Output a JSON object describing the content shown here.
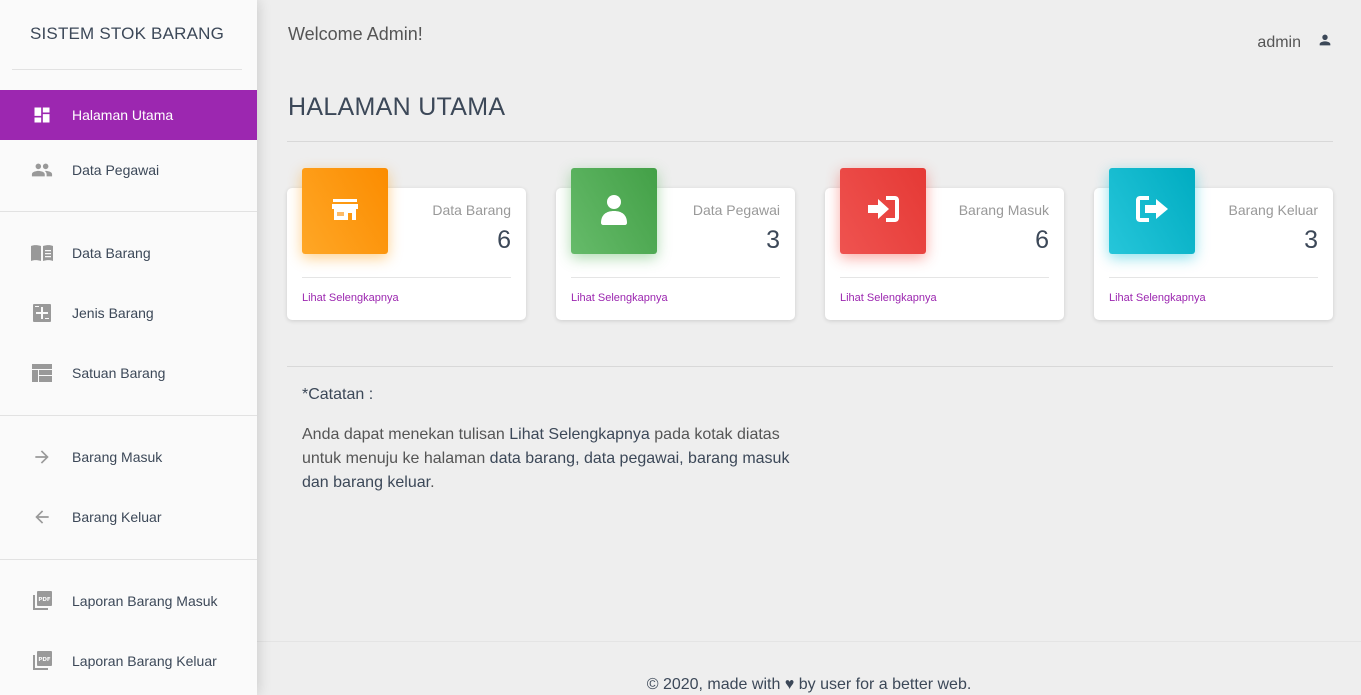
{
  "colors": {
    "accent": "#9c27b0",
    "orange": "#fb8c00",
    "green": "#43a047",
    "red": "#e53935",
    "cyan": "#00acc1"
  },
  "sidebar": {
    "brand": "SISTEM STOK BARANG",
    "items": [
      {
        "label": "Halaman Utama",
        "icon": "dashboard-icon",
        "active": true
      },
      {
        "label": "Data Pegawai",
        "icon": "people-icon"
      },
      {
        "label": "Data Barang",
        "icon": "book-icon"
      },
      {
        "label": "Jenis Barang",
        "icon": "category-icon"
      },
      {
        "label": "Satuan Barang",
        "icon": "table-icon"
      },
      {
        "label": "Barang Masuk",
        "icon": "arrow-right-icon"
      },
      {
        "label": "Barang Keluar",
        "icon": "arrow-left-icon"
      },
      {
        "label": "Laporan Barang Masuk",
        "icon": "pdf-icon"
      },
      {
        "label": "Laporan Barang Keluar",
        "icon": "pdf-icon"
      }
    ]
  },
  "header": {
    "welcome": "Welcome Admin!",
    "username": "admin",
    "user_icon": "person-icon"
  },
  "page": {
    "title": "HALAMAN UTAMA"
  },
  "cards": [
    {
      "title": "Data Barang",
      "value": "6",
      "link": "Lihat Selengkapnya",
      "icon": "store-icon",
      "color": "orange"
    },
    {
      "title": "Data Pegawai",
      "value": "3",
      "link": "Lihat Selengkapnya",
      "icon": "person-icon",
      "color": "green"
    },
    {
      "title": "Barang Masuk",
      "value": "6",
      "link": "Lihat Selengkapnya",
      "icon": "sign-in-icon",
      "color": "red"
    },
    {
      "title": "Barang Keluar",
      "value": "3",
      "link": "Lihat Selengkapnya",
      "icon": "sign-out-icon",
      "color": "cyan"
    }
  ],
  "note": {
    "heading": "*Catatan :",
    "text_1": "Anda dapat menekan tulisan ",
    "bold_1": "Lihat Selengkapnya",
    "text_2": " pada kotak diatas untuk menuju ke halaman ",
    "bold_2": "data barang, data pegawai, barang masuk dan barang keluar",
    "text_3": "."
  },
  "footer": {
    "prefix": "© 2020, made with",
    "heart": "♥",
    "suffix": "by user for a better web."
  }
}
